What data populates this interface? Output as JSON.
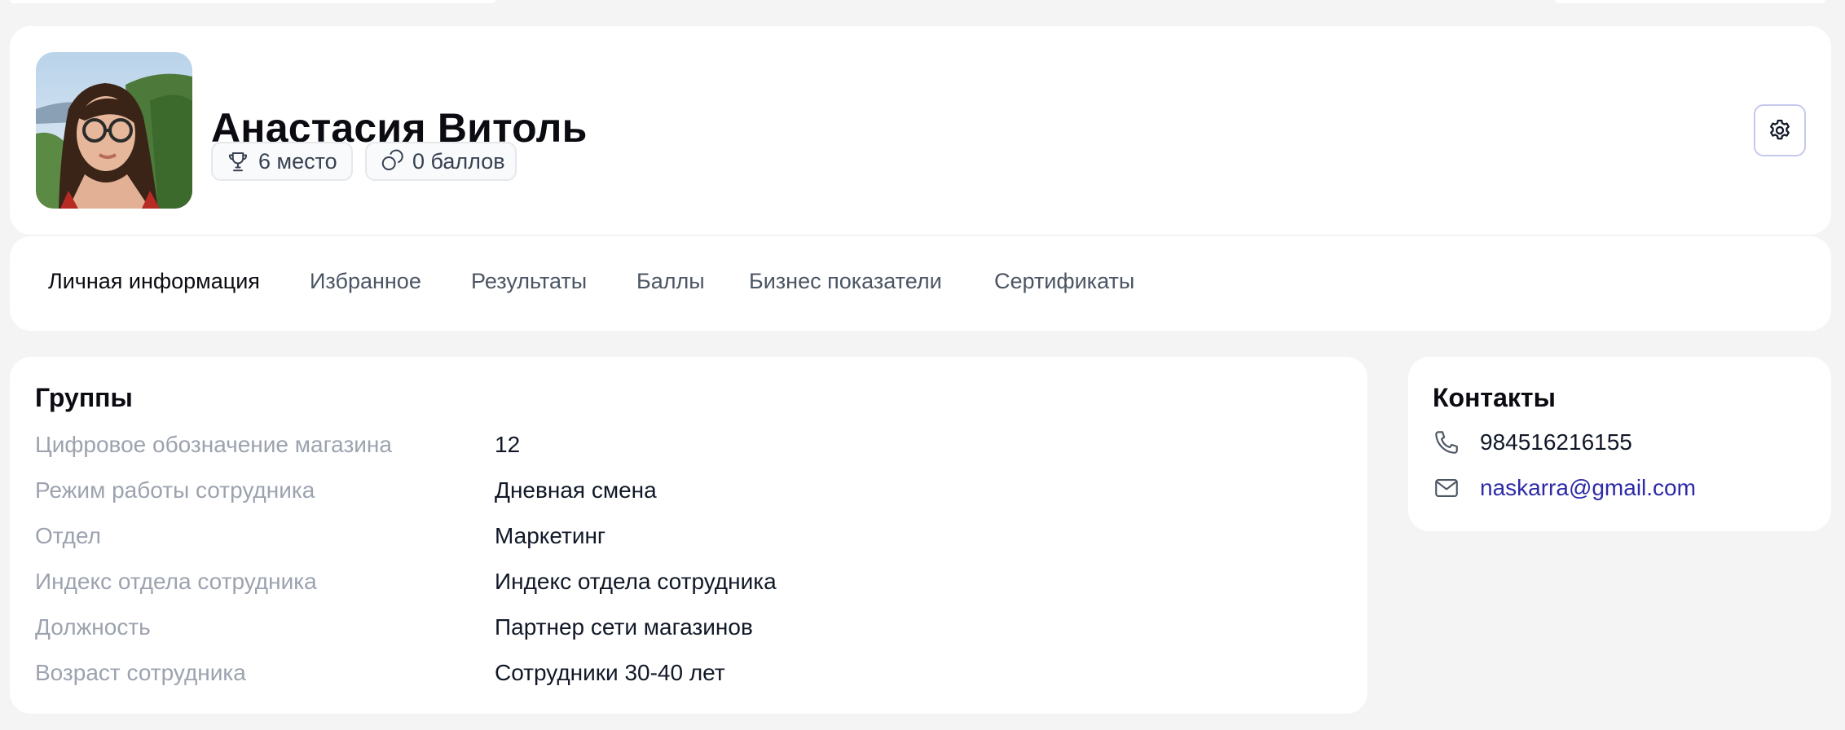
{
  "profile": {
    "name": "Анастасия Витоль",
    "rank_label": "6 место",
    "points_label": "0 баллов"
  },
  "tabs": [
    {
      "label": "Личная информация",
      "active": true
    },
    {
      "label": "Избранное",
      "active": false
    },
    {
      "label": "Результаты",
      "active": false
    },
    {
      "label": "Баллы",
      "active": false
    },
    {
      "label": "Бизнес показатели",
      "active": false
    },
    {
      "label": "Сертификаты",
      "active": false
    }
  ],
  "groups": {
    "title": "Группы",
    "fields": [
      {
        "label": "Цифровое обозначение магазина",
        "value": "12"
      },
      {
        "label": "Режим работы сотрудника",
        "value": "Дневная смена"
      },
      {
        "label": "Отдел",
        "value": "Маркетинг"
      },
      {
        "label": "Индекс отдела сотрудника",
        "value": "Индекс отдела сотрудника"
      },
      {
        "label": "Должность",
        "value": "Партнер сети магазинов"
      },
      {
        "label": "Возраст сотрудника",
        "value": "Сотрудники 30-40 лет"
      }
    ]
  },
  "contacts": {
    "title": "Контакты",
    "phone": "984516216155",
    "email": "naskarra@gmail.com"
  },
  "icons": {
    "rank": "trophy-icon",
    "points": "coins-icon",
    "settings": "gear-icon",
    "phone": "phone-icon",
    "email": "mail-icon"
  },
  "colors": {
    "background": "#f4f4f5",
    "card": "#ffffff",
    "link": "#2d2aa8",
    "muted_label": "#9ca3af",
    "settings_border": "#c7c8ee"
  }
}
